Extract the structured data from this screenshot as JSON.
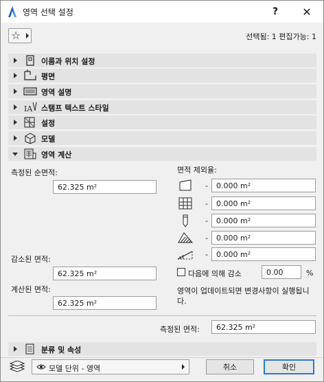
{
  "window": {
    "title": "영역 선택 설정",
    "help": "?",
    "close": "✕"
  },
  "header": {
    "selection_info": "선택됨: 1 편집가능: 1"
  },
  "sections": [
    {
      "label": "이름과 위치 설정",
      "icon": "tag-icon"
    },
    {
      "label": "평면",
      "icon": "floorplan-icon"
    },
    {
      "label": "영역 설명",
      "icon": "keyboard-icon"
    },
    {
      "label": "스탬프 텍스트 스타일",
      "icon": "text-style-icon"
    },
    {
      "label": "설정",
      "icon": "settings-grid-icon"
    },
    {
      "label": "모델",
      "icon": "model-box-icon"
    },
    {
      "label": "영역 계산",
      "icon": "calculator-icon"
    }
  ],
  "calc": {
    "measured_net_label": "측정된 순면적:",
    "measured_net_value": "62.325 m²",
    "deducted_label": "감소된 면적:",
    "deducted_value": "62.325 m²",
    "calculated_label": "계산된 면적:",
    "calculated_value": "62.325 m²",
    "exclusions_label": "면적 제외율:",
    "exclusions": [
      {
        "icon": "wall-fill-icon",
        "value": "0.000 m²"
      },
      {
        "icon": "grid-cover-icon",
        "value": "0.000 m²"
      },
      {
        "icon": "column-icon",
        "value": "0.000 m²"
      },
      {
        "icon": "hatch-zone-icon",
        "value": "0.000 m²"
      },
      {
        "icon": "slope-roof-icon",
        "value": "0.000 m²"
      }
    ],
    "dash": "-",
    "reduce_label": "다음에 의해 감소",
    "reduce_value": "0.00",
    "reduce_unit": "%",
    "update_note": "영역이 업데이트되면 변경사항이 실행됩니다.",
    "measured_area_label": "측정된 면적:",
    "measured_area_value": "62.325 m²"
  },
  "classification": {
    "label": "분류 및 속성",
    "icon": "document-icon"
  },
  "footer": {
    "layer_dropdown": "모델 단위 - 영역",
    "cancel": "취소",
    "ok": "확인"
  },
  "colors": {
    "accent": "#2a78d4",
    "section_bg": "#e3e3e3",
    "window_bg": "#f0f0f0"
  }
}
